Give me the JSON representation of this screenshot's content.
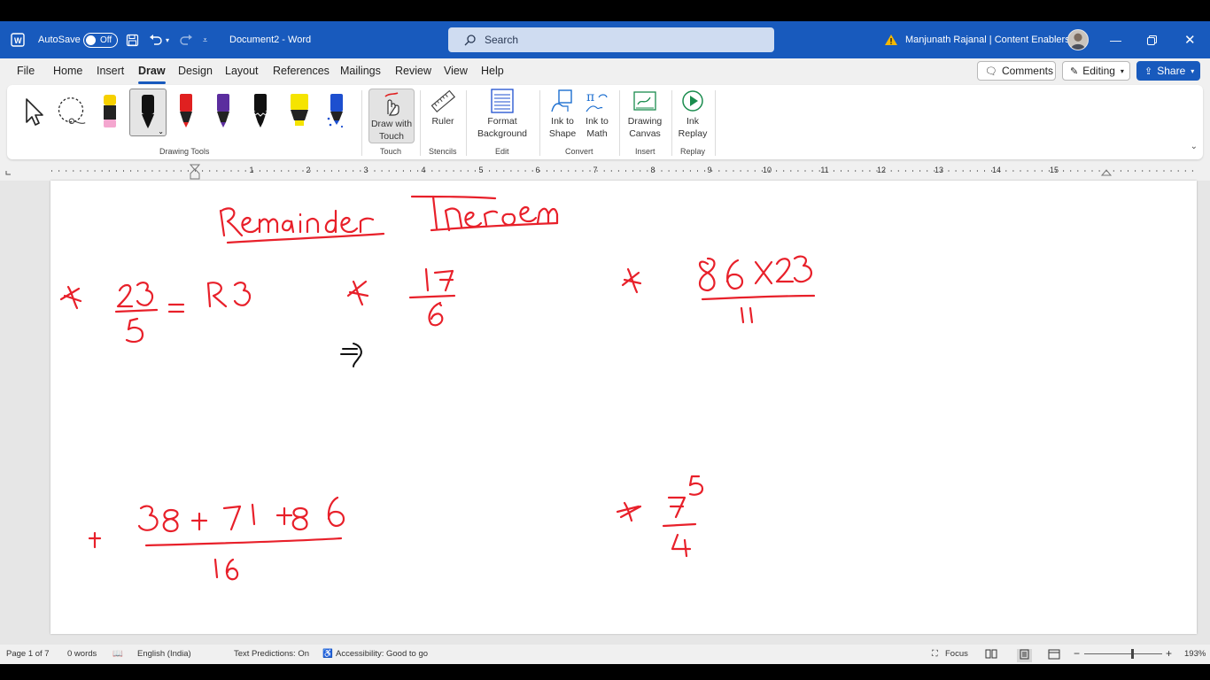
{
  "titlebar": {
    "autosave_label": "AutoSave",
    "autosave_state": "Off",
    "document_title": "Document2  -  Word",
    "search_placeholder": "Search",
    "user": "Manjunath Rajanal | Content Enablers",
    "accent_color": "#185abd"
  },
  "menu": {
    "tabs": [
      "File",
      "Home",
      "Insert",
      "Draw",
      "Design",
      "Layout",
      "References",
      "Mailings",
      "Review",
      "View",
      "Help"
    ],
    "active_tab": "Draw",
    "comments_label": "Comments",
    "editing_label": "Editing",
    "share_label": "Share"
  },
  "ribbon": {
    "groups": {
      "drawing_tools": "Drawing Tools",
      "touch": "Touch",
      "stencils": "Stencils",
      "edit": "Edit",
      "convert": "Convert",
      "insert": "Insert",
      "replay": "Replay"
    },
    "buttons": {
      "draw_with_touch": "Draw with Touch",
      "ruler": "Ruler",
      "format_background": "Format Background",
      "ink_to_shape": "Ink to Shape",
      "ink_to_math": "Ink to Math",
      "drawing_canvas": "Drawing Canvas",
      "ink_replay": "Ink Replay"
    },
    "pen_colors": [
      "#f6d000",
      "#111111",
      "#e02020",
      "#5b2d9e",
      "#111111",
      "#f5e400",
      "#1d4fcf"
    ]
  },
  "ruler": {
    "numbers": [
      "1",
      "2",
      "3",
      "4",
      "5",
      "6",
      "7",
      "8",
      "9",
      "10",
      "11",
      "12",
      "13",
      "14",
      "15"
    ]
  },
  "document": {
    "ink_color": "#e8202a",
    "ink_secondary_color": "#111111",
    "handwriting": {
      "title": "Remainder Theorem",
      "problem1": "23 / 5 = R3",
      "problem2": "17 / 6 ⇒",
      "problem3": "86 X 23 / 11",
      "problem4": "38 + 71 + 86 / 16",
      "problem5": "7^5 / 4"
    }
  },
  "statusbar": {
    "page": "Page 1 of 7",
    "words": "0 words",
    "language": "English (India)",
    "text_predictions": "Text Predictions: On",
    "accessibility": "Accessibility: Good to go",
    "focus": "Focus",
    "zoom": "193%"
  }
}
